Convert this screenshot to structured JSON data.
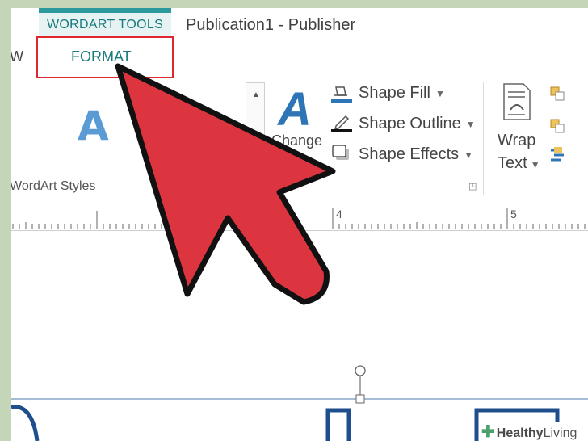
{
  "window": {
    "context_tab_group": "WORDART TOOLS",
    "title": "Publication1 - Publisher"
  },
  "tabs": {
    "view_partial": "W",
    "format": "FORMAT"
  },
  "ribbon": {
    "wordart_styles_group": "WordArt Styles",
    "gallery_sample": "A",
    "change_label": "Change",
    "shape_fill": "Shape Fill",
    "shape_outline": "Shape Outline",
    "shape_effects": "Shape Effects",
    "wrap_text_line1": "Wrap",
    "wrap_text_line2": "Text"
  },
  "ruler": {
    "marks": [
      "4",
      "5"
    ]
  },
  "watermark": {
    "brand_part1": "Healthy",
    "brand_part2": "Living"
  },
  "colors": {
    "accent_teal": "#2c9a9c",
    "highlight_red": "#e0262f",
    "pointer_red": "#dc3540",
    "wordart_blue": "#2e75b6"
  }
}
